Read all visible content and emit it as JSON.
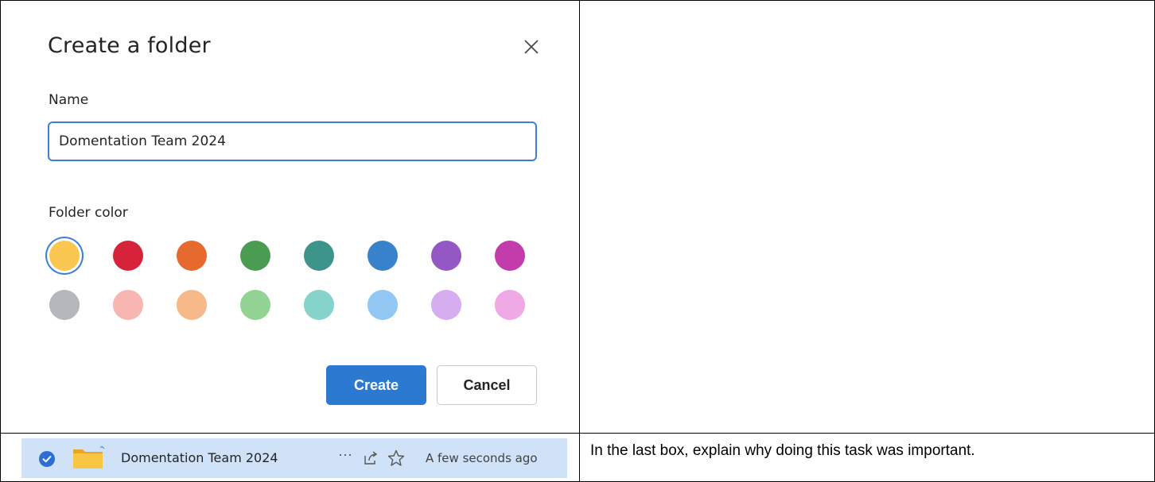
{
  "dialog": {
    "title": "Create a folder",
    "name_label": "Name",
    "name_value": "Domentation Team 2024",
    "color_label": "Folder color",
    "selected_color_index": 0,
    "colors_row1": [
      "#f9c74f",
      "#d7233a",
      "#e66a2e",
      "#4a9c52",
      "#3d948b",
      "#3782cb",
      "#9458c4",
      "#c23cac"
    ],
    "colors_row2": [
      "#b4b7bb",
      "#f8b6b3",
      "#f7b98a",
      "#93d393",
      "#85d3cb",
      "#91c7f2",
      "#d6adef",
      "#efa9e4"
    ],
    "create_label": "Create",
    "cancel_label": "Cancel",
    "close_icon": "close-icon"
  },
  "file_row": {
    "name": "Domentation Team 2024",
    "modified": "A few seconds ago",
    "more_label": "···",
    "icons": [
      "check-circle-icon",
      "folder-icon",
      "share-icon",
      "star-icon"
    ]
  },
  "instruction": "In the last box, explain why doing this task was important."
}
